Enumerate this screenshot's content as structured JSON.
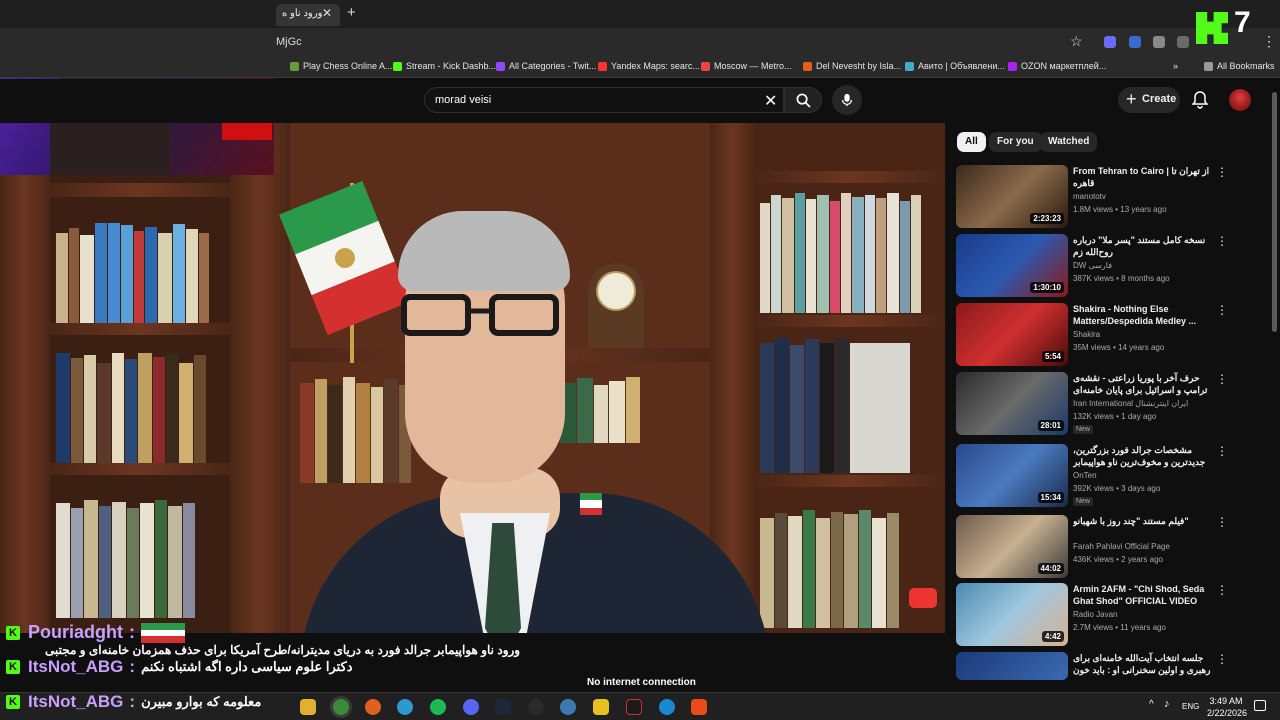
{
  "browser": {
    "tab_title": "ورود ناو ه",
    "url": "MjGc",
    "bookmarks": [
      {
        "label": "Play Chess Online A...",
        "color": "#6b9a3a"
      },
      {
        "label": "Stream - Kick Dashb...",
        "color": "#53fc18"
      },
      {
        "label": "All Categories - Twit...",
        "color": "#9146ff"
      },
      {
        "label": "Yandex Maps: searc...",
        "color": "#f33"
      },
      {
        "label": "Moscow — Metro...",
        "color": "#e44"
      },
      {
        "label": "Del Nevesht by Isla...",
        "color": "#e85d1a"
      },
      {
        "label": "Авито | Объявлени...",
        "color": "#4ac"
      },
      {
        "label": "OZON маркетплей...",
        "color": "#a2e"
      }
    ],
    "all_bookmarks_label": "All Bookmarks"
  },
  "youtube": {
    "search_value": "morad veisi",
    "create_label": "Create",
    "chips": [
      "All",
      "For you",
      "Watched"
    ],
    "active_chip": "All"
  },
  "recommendations": [
    {
      "title": "From Tehran to Cairo | از تهران تا قاهره",
      "channel": "manototv",
      "meta": "1.8M views • 13 years ago",
      "duration": "2:23:23",
      "badge": ""
    },
    {
      "title": "نسخه کامل مستند \"پسر ملا\" درباره روح‌الله زم",
      "channel": "DW فارسی",
      "meta": "387K views • 8 months ago",
      "duration": "1:30:10",
      "badge": ""
    },
    {
      "title": "Shakira - Nothing Else Matters/Despedida Medley ...",
      "channel": "Shakira",
      "meta": "35M views • 14 years ago",
      "duration": "5:54",
      "badge": ""
    },
    {
      "title": "حرف آخر با پوریا زراعتی - نقشه‌ی ترامپ و اسرائیل برای پایان خامنه‌ای",
      "channel": "Iran International ایران اینترنشنال",
      "meta": "132K views • 1 day ago",
      "duration": "28:01",
      "badge": "New"
    },
    {
      "title": "مشخصات جرالد فورد بزرگترین، جدیدترین و مخوف‌ترین ناو هواپیمابر آمریکا",
      "channel": "OnTen",
      "meta": "392K views • 3 days ago",
      "duration": "15:34",
      "badge": "New"
    },
    {
      "title": "فیلم مستند \"چند روز با شهبانو\"",
      "channel": "Farah Pahlavi Official Page",
      "meta": "436K views • 2 years ago",
      "duration": "44:02",
      "badge": ""
    },
    {
      "title": "Armin 2AFM - \"Chi Shod, Seda Ghat Shod\" OFFICIAL VIDEO",
      "channel": "Radio Javan",
      "meta": "2.7M views • 11 years ago",
      "duration": "4:42",
      "badge": ""
    },
    {
      "title": "جلسه انتخاب آیت‌الله خامنه‌ای برای رهبری و اولین سخنرانی او : باید خون گریست",
      "channel": "",
      "meta": "",
      "duration": "",
      "badge": ""
    }
  ],
  "video": {
    "caption": "ورود ناو هواپیمابر جرالد فورد به دریای مدیترانه/طرح آمریکا برای حذف همزمان خامنه‌ای و مجتبی",
    "no_connection": "No internet connection"
  },
  "chat": [
    {
      "user": "Pouriadght",
      "sep": ":",
      "text": ""
    },
    {
      "user": "ItsNot_ABG",
      "sep": ":",
      "text": "دکترا علوم سیاسی داره اگه اشتباه نکنم"
    },
    {
      "user": "ItsNot_ABG",
      "sep": ":",
      "text": "معلومه که بوارو مبیرن"
    }
  ],
  "overlay": {
    "kick_number": "7"
  },
  "taskbar": {
    "lang": "ENG",
    "time": "3:49 AM",
    "date": "2/22/2026"
  }
}
